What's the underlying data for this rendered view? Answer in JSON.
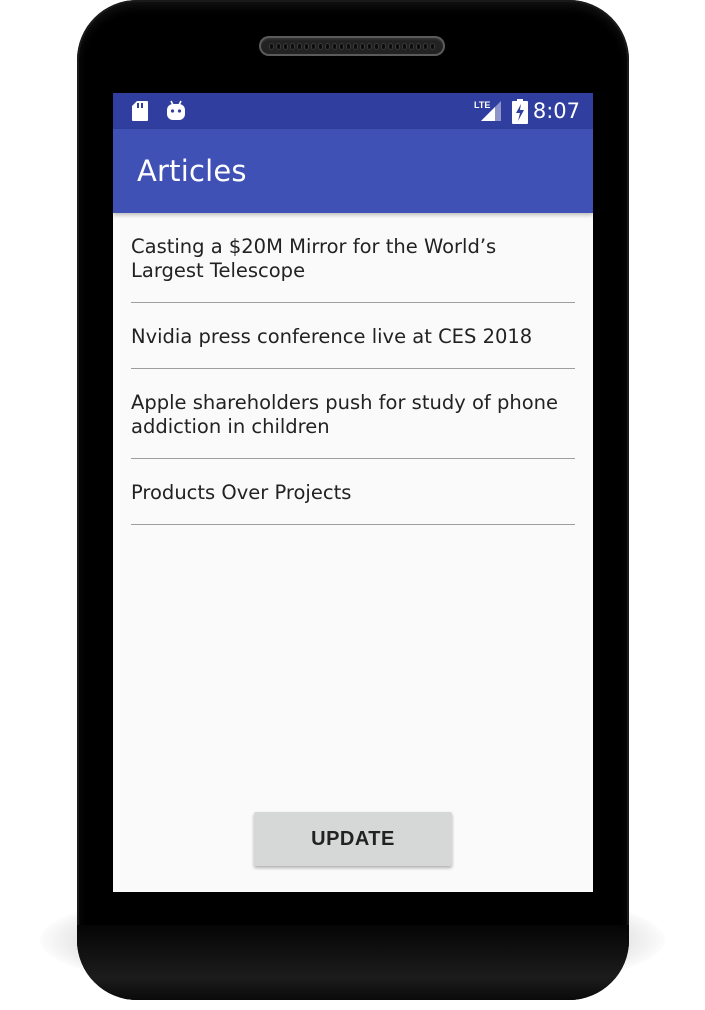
{
  "status_bar": {
    "time": "8:07",
    "network": "LTE",
    "icons": [
      "sd-card-icon",
      "android-debug-icon",
      "lte-signal-icon",
      "battery-charging-icon"
    ]
  },
  "toolbar": {
    "title": "Articles"
  },
  "articles": [
    {
      "title": "Casting a $20M Mirror for the World’s Largest Telescope"
    },
    {
      "title": "Nvidia press conference live at CES 2018"
    },
    {
      "title": "Apple shareholders push for study of phone addiction in children"
    },
    {
      "title": "Products Over Projects"
    }
  ],
  "actions": {
    "update_label": "UPDATE"
  },
  "colors": {
    "status_bar": "#303f9f",
    "toolbar": "#3f51b5",
    "background": "#fafafa",
    "button": "#d6d7d7",
    "divider": "#9e9e9e"
  }
}
